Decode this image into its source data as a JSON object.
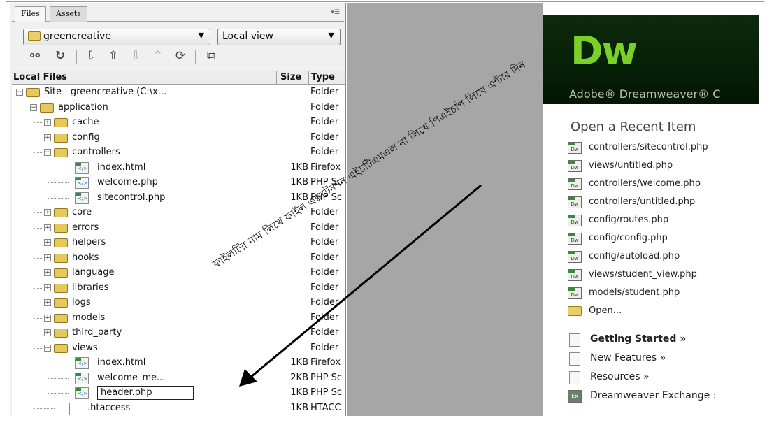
{
  "panel": {
    "tabs": [
      "Files",
      "Assets"
    ],
    "site_select": "greencreative",
    "view_select": "Local view",
    "columns": {
      "name": "Local Files",
      "size": "Size",
      "type": "Type"
    },
    "tree": [
      {
        "depth": 0,
        "exp": "minus",
        "icon": "folder",
        "name": "Site - greencreative (C:\\x...",
        "size": "",
        "type": "Folder"
      },
      {
        "depth": 1,
        "exp": "minus",
        "icon": "folder",
        "name": "application",
        "size": "",
        "type": "Folder"
      },
      {
        "depth": 2,
        "exp": "plus",
        "icon": "folder",
        "name": "cache",
        "size": "",
        "type": "Folder"
      },
      {
        "depth": 2,
        "exp": "plus",
        "icon": "folder",
        "name": "config",
        "size": "",
        "type": "Folder"
      },
      {
        "depth": 2,
        "exp": "minus",
        "icon": "folder",
        "name": "controllers",
        "size": "",
        "type": "Folder"
      },
      {
        "depth": 3,
        "exp": "",
        "icon": "file",
        "name": "index.html",
        "size": "1KB",
        "type": "Firefox"
      },
      {
        "depth": 3,
        "exp": "",
        "icon": "file",
        "name": "welcome.php",
        "size": "1KB",
        "type": "PHP Sc"
      },
      {
        "depth": 3,
        "exp": "",
        "icon": "file",
        "name": "sitecontrol.php",
        "size": "1KB",
        "type": "PHP Sc"
      },
      {
        "depth": 2,
        "exp": "plus",
        "icon": "folder",
        "name": "core",
        "size": "",
        "type": "Folder"
      },
      {
        "depth": 2,
        "exp": "plus",
        "icon": "folder",
        "name": "errors",
        "size": "",
        "type": "Folder"
      },
      {
        "depth": 2,
        "exp": "plus",
        "icon": "folder",
        "name": "helpers",
        "size": "",
        "type": "Folder"
      },
      {
        "depth": 2,
        "exp": "plus",
        "icon": "folder",
        "name": "hooks",
        "size": "",
        "type": "Folder"
      },
      {
        "depth": 2,
        "exp": "plus",
        "icon": "folder",
        "name": "language",
        "size": "",
        "type": "Folder"
      },
      {
        "depth": 2,
        "exp": "plus",
        "icon": "folder",
        "name": "libraries",
        "size": "",
        "type": "Folder"
      },
      {
        "depth": 2,
        "exp": "plus",
        "icon": "folder",
        "name": "logs",
        "size": "",
        "type": "Folder"
      },
      {
        "depth": 2,
        "exp": "plus",
        "icon": "folder",
        "name": "models",
        "size": "",
        "type": "Folder"
      },
      {
        "depth": 2,
        "exp": "plus",
        "icon": "folder",
        "name": "third_party",
        "size": "",
        "type": "Folder"
      },
      {
        "depth": 2,
        "exp": "minus",
        "icon": "folder",
        "name": "views",
        "size": "",
        "type": "Folder"
      },
      {
        "depth": 3,
        "exp": "",
        "icon": "file",
        "name": "index.html",
        "size": "1KB",
        "type": "Firefox"
      },
      {
        "depth": 3,
        "exp": "",
        "icon": "file",
        "name": "welcome_me...",
        "size": "2KB",
        "type": "PHP Sc"
      },
      {
        "depth": 3,
        "exp": "",
        "icon": "file",
        "name": "header.php",
        "size": "1KB",
        "type": "PHP Sc",
        "editing": true
      },
      {
        "depth": 2,
        "exp": "",
        "icon": "blank",
        "name": ".htaccess",
        "size": "1KB",
        "type": "HTACC"
      }
    ]
  },
  "start": {
    "logo": "Dw",
    "product": "Adobe® Dreamweaver® C",
    "recent_title": "Open a Recent Item",
    "recent": [
      "controllers/sitecontrol.php",
      "views/untitled.php",
      "controllers/welcome.php",
      "controllers/untitled.php",
      "config/routes.php",
      "config/config.php",
      "config/autoload.php",
      "views/student_view.php",
      "models/student.php"
    ],
    "open_label": "Open...",
    "links": [
      {
        "label": "Getting Started »",
        "bold": true,
        "icon": "doc"
      },
      {
        "label": "New Features »",
        "bold": false,
        "icon": "doc"
      },
      {
        "label": "Resources »",
        "bold": false,
        "icon": "doc"
      },
      {
        "label": "Dreamweaver Exchange :",
        "bold": false,
        "icon": "exchange"
      }
    ]
  },
  "annotation": {
    "text": "ফাইলটির নাম লিখে ফাইল এক্সটেনশন এইচটিএমএল না লিখে পিএইচপি লিখে এন্টার দিন"
  }
}
